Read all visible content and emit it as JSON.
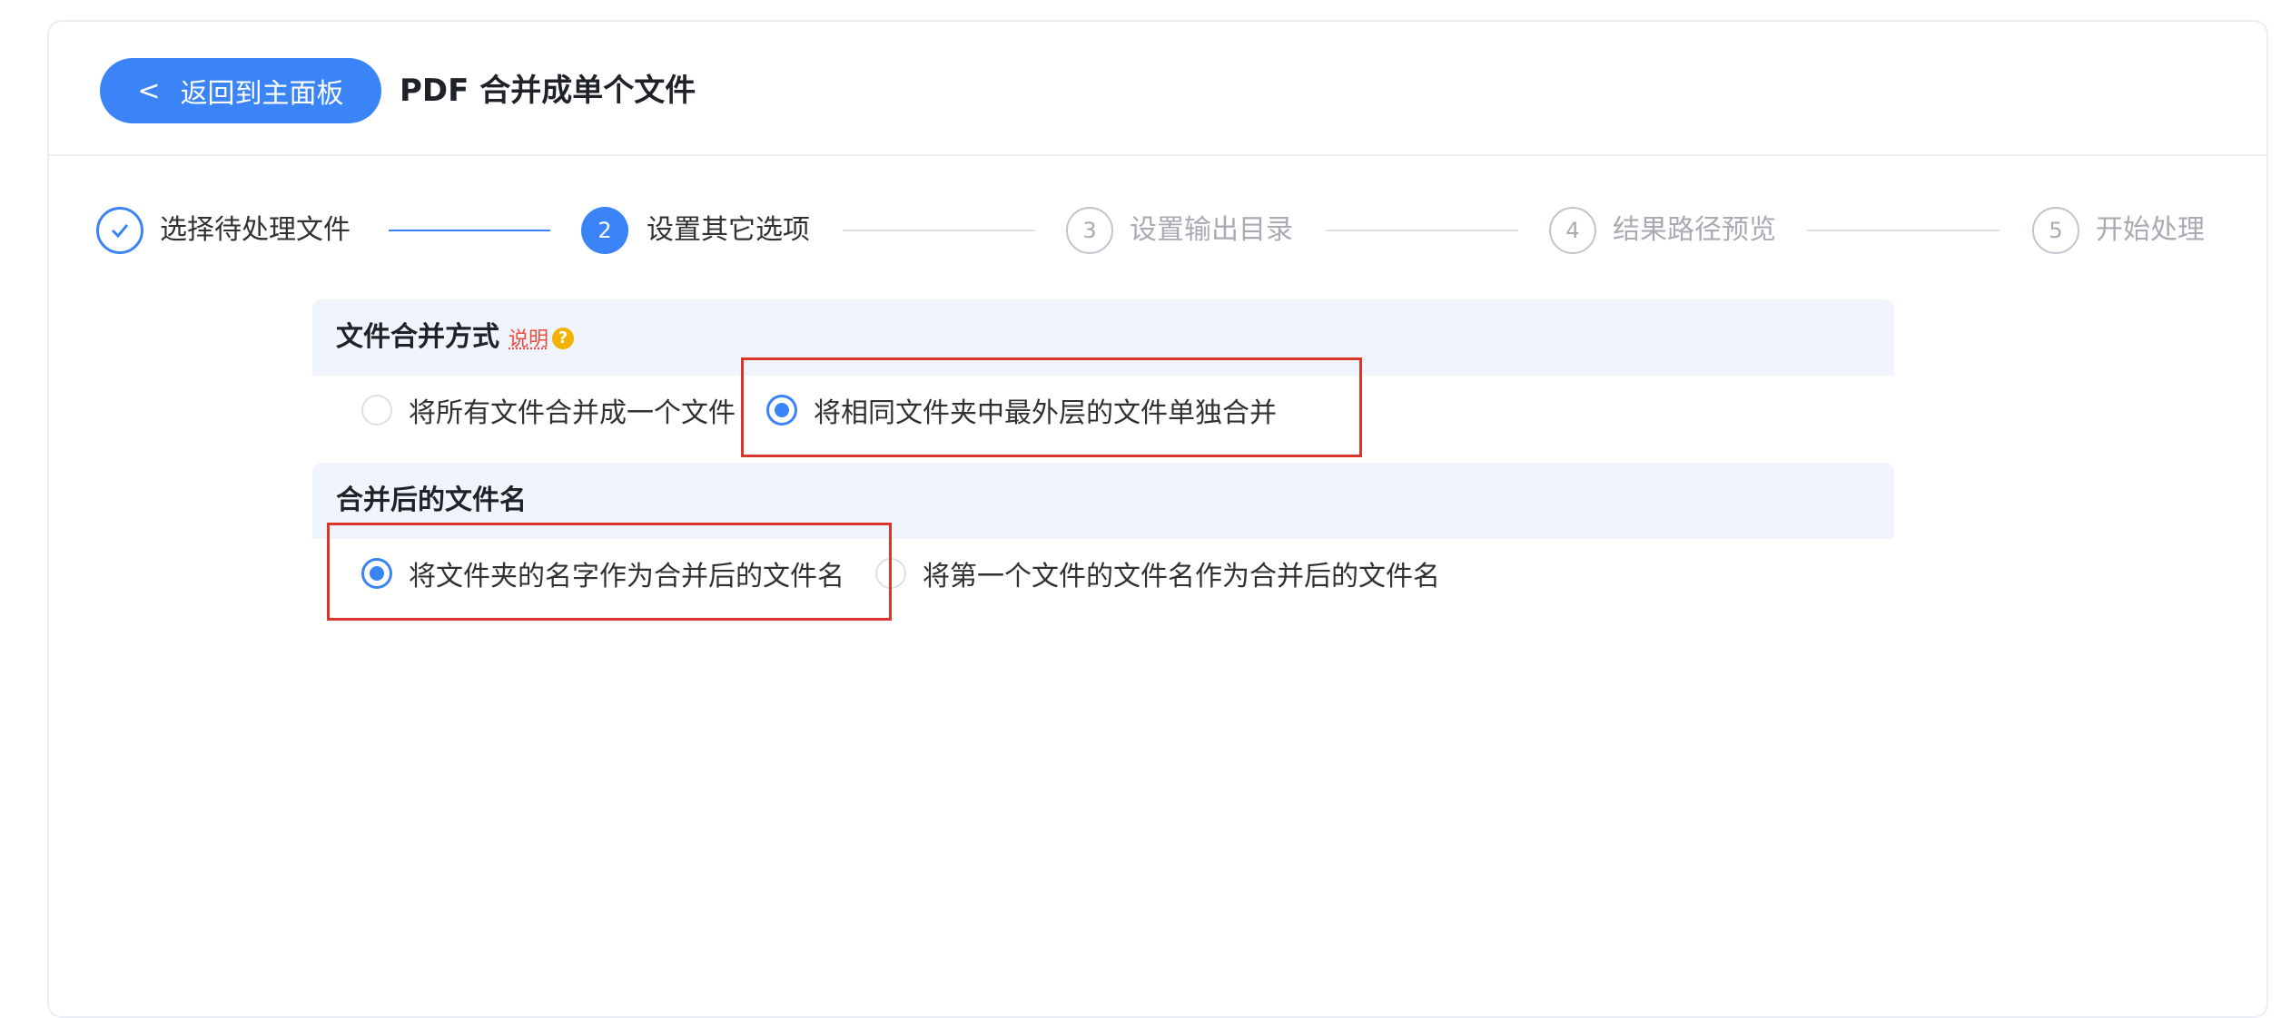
{
  "header": {
    "back_label": "返回到主面板",
    "title": "PDF 合并成单个文件"
  },
  "steps": [
    {
      "number": "✓",
      "label": "选择待处理文件",
      "status": "done"
    },
    {
      "number": "2",
      "label": "设置其它选项",
      "status": "active"
    },
    {
      "number": "3",
      "label": "设置输出目录",
      "status": "wait"
    },
    {
      "number": "4",
      "label": "结果路径预览",
      "status": "wait"
    },
    {
      "number": "5",
      "label": "开始处理",
      "status": "wait"
    }
  ],
  "merge_mode": {
    "title": "文件合并方式",
    "help_label": "说明",
    "help_icon": "?",
    "options": [
      {
        "label": "将所有文件合并成一个文件",
        "checked": false
      },
      {
        "label": "将相同文件夹中最外层的文件单独合并",
        "checked": true
      }
    ]
  },
  "filename": {
    "title": "合并后的文件名",
    "options": [
      {
        "label": "将文件夹的名字作为合并后的文件名",
        "checked": true
      },
      {
        "label": "将第一个文件的文件名作为合并后的文件名",
        "checked": false
      }
    ]
  },
  "colors": {
    "primary": "#3a84f7",
    "highlight": "#d9362b",
    "section_bg": "#f0f5fd"
  }
}
